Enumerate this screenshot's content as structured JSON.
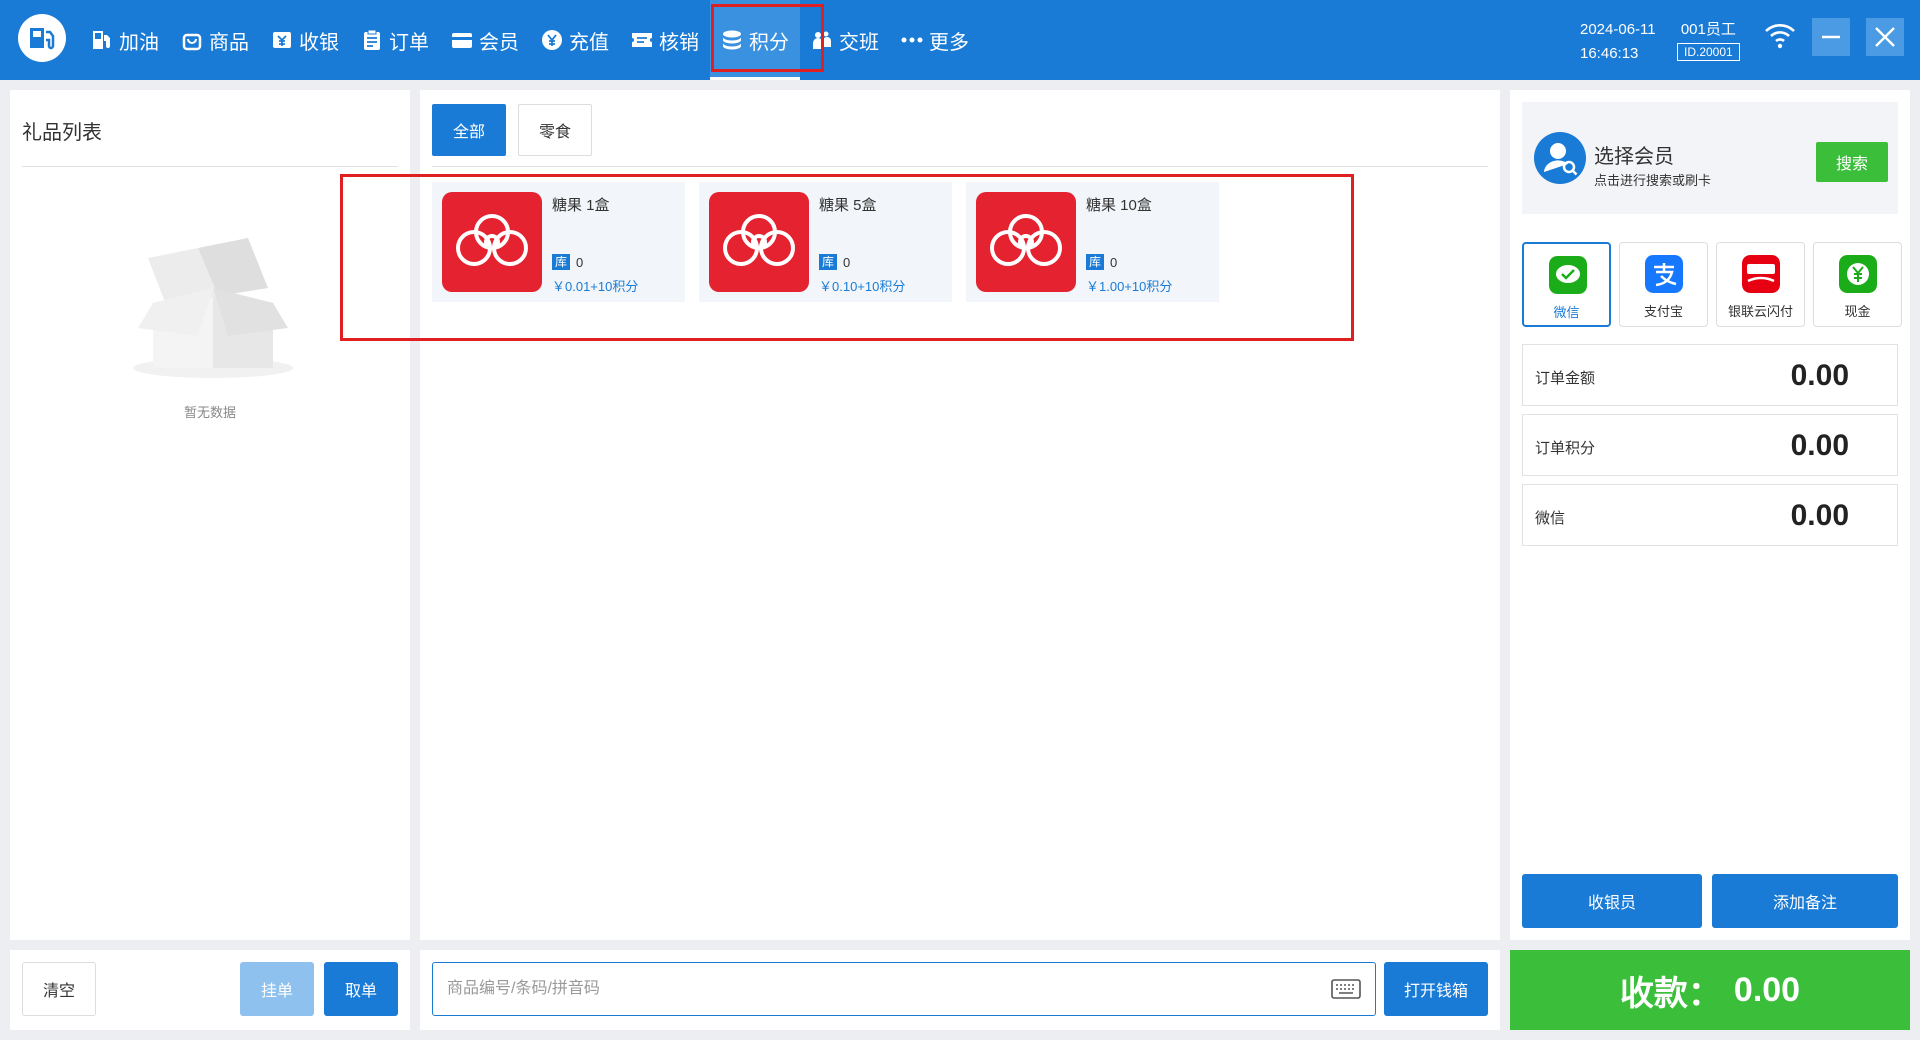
{
  "nav": {
    "items": [
      {
        "label": "加油",
        "icon": "fuel-icon"
      },
      {
        "label": "商品",
        "icon": "bag-icon"
      },
      {
        "label": "收银",
        "icon": "cashier-icon"
      },
      {
        "label": "订单",
        "icon": "clipboard-icon"
      },
      {
        "label": "会员",
        "icon": "card-icon"
      },
      {
        "label": "充值",
        "icon": "yen-circle-icon"
      },
      {
        "label": "核销",
        "icon": "ticket-icon"
      },
      {
        "label": "积分",
        "icon": "coins-icon"
      },
      {
        "label": "交班",
        "icon": "people-icon"
      },
      {
        "label": "更多",
        "icon": "more-dots-icon"
      }
    ],
    "active_index": 7
  },
  "header": {
    "date": "2024-06-11",
    "time": "16:46:13",
    "user": "001员工",
    "user_id": "ID.20001"
  },
  "left": {
    "title": "礼品列表",
    "empty_text": "暂无数据",
    "clear_label": "清空",
    "hold_label": "挂单",
    "retrieve_label": "取单"
  },
  "middle": {
    "tabs": [
      "全部",
      "零食"
    ],
    "active_tab": 0,
    "products": [
      {
        "name": "糖果 1盒",
        "stock_tag": "库",
        "stock": "0",
        "price": "￥0.01+10积分"
      },
      {
        "name": "糖果 5盒",
        "stock_tag": "库",
        "stock": "0",
        "price": "￥0.10+10积分"
      },
      {
        "name": "糖果 10盒",
        "stock_tag": "库",
        "stock": "0",
        "price": "￥1.00+10积分"
      }
    ],
    "search_placeholder": "商品编号/条码/拼音码",
    "open_drawer_label": "打开钱箱"
  },
  "right": {
    "member_title": "选择会员",
    "member_sub": "点击进行搜索或刷卡",
    "search_label": "搜索",
    "payments": [
      {
        "label": "微信",
        "icon": "wechat-pay-icon",
        "color": "#1aad19"
      },
      {
        "label": "支付宝",
        "icon": "alipay-icon",
        "color": "#1677ff"
      },
      {
        "label": "银联云闪付",
        "icon": "unionpay-quickpass-icon",
        "color": "#e60012"
      },
      {
        "label": "现金",
        "icon": "cash-icon",
        "color": "#1aad19"
      }
    ],
    "active_payment": 0,
    "amounts": [
      {
        "label": "订单金额",
        "value": "0.00"
      },
      {
        "label": "订单积分",
        "value": "0.00"
      },
      {
        "label": "微信",
        "value": "0.00"
      }
    ],
    "cashier_label": "收银员",
    "note_label": "添加备注",
    "pay_label": "收款：",
    "pay_value": "0.00"
  },
  "colors": {
    "primary": "#1a7bd6",
    "success": "#3bbf3b",
    "highlight": "#e02020",
    "product": "#e52330"
  }
}
